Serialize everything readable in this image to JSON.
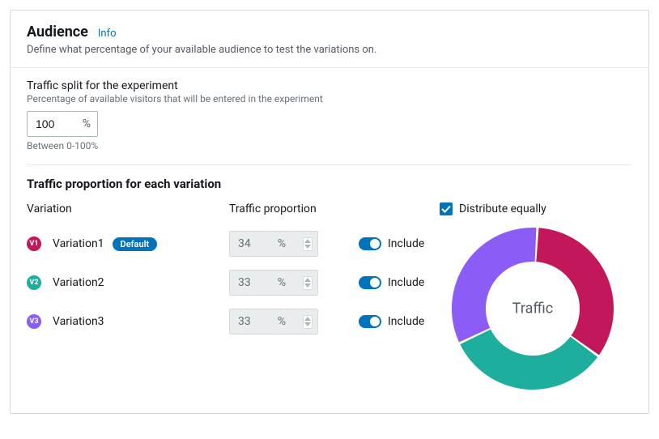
{
  "header": {
    "title": "Audience",
    "info_label": "Info",
    "description": "Define what percentage of your available audience to test the variations on."
  },
  "traffic_split": {
    "label": "Traffic split for the experiment",
    "hint": "Percentage of available visitors that will be entered in the experiment",
    "value": "100",
    "pct": "%",
    "below": "Between 0-100%"
  },
  "proportion": {
    "heading": "Traffic proportion for each variation",
    "col_variation": "Variation",
    "col_prop": "Traffic proportion",
    "distribute_label": "Distribute equally",
    "distribute_checked": true,
    "include_label": "Include",
    "items": [
      {
        "badge": "V1",
        "name": "Variation1",
        "is_default": true,
        "value": "34",
        "color": "#c2185b"
      },
      {
        "badge": "V2",
        "name": "Variation2",
        "is_default": false,
        "value": "33",
        "color": "#1dae9e"
      },
      {
        "badge": "V3",
        "name": "Variation3",
        "is_default": false,
        "value": "33",
        "color": "#8b5cf6"
      }
    ],
    "default_label": "Default"
  },
  "chart": {
    "center_label": "Traffic"
  },
  "chart_data": {
    "type": "pie",
    "title": "Traffic",
    "series": [
      {
        "name": "Variation1",
        "value": 34,
        "color": "#c2185b"
      },
      {
        "name": "Variation2",
        "value": 33,
        "color": "#1dae9e"
      },
      {
        "name": "Variation3",
        "value": 33,
        "color": "#8b5cf6"
      }
    ]
  }
}
